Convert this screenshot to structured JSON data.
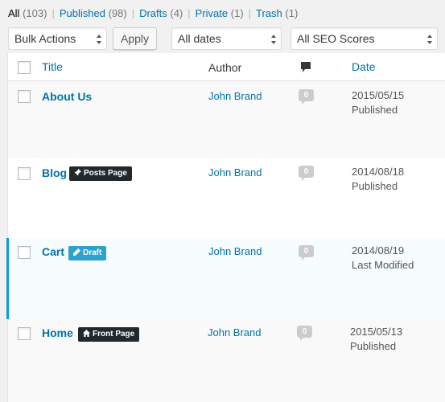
{
  "filters": [
    {
      "label": "All",
      "count": "(103)",
      "current": true
    },
    {
      "label": "Published",
      "count": "(98)"
    },
    {
      "label": "Drafts",
      "count": "(4)"
    },
    {
      "label": "Private",
      "count": "(1)"
    },
    {
      "label": "Trash",
      "count": "(1)"
    }
  ],
  "toolbar": {
    "bulk_actions": "Bulk Actions",
    "apply": "Apply",
    "dates": "All dates",
    "seo": "All SEO Scores"
  },
  "columns": {
    "title": "Title",
    "author": "Author",
    "date": "Date",
    "comments_icon": "comment-icon"
  },
  "rows": [
    {
      "title": "About Us",
      "author": "John Brand",
      "comments": "0",
      "date": "2015/05/15",
      "status": "Published"
    },
    {
      "title": "Blog",
      "badge": "Posts Page",
      "badge_icon": "pin-icon",
      "author": "John Brand",
      "comments": "0",
      "date": "2014/08/18",
      "status": "Published"
    },
    {
      "title": "Cart",
      "badge": "Draft",
      "badge_icon": "pencil-icon",
      "author": "John Brand",
      "comments": "0",
      "date": "2014/08/19",
      "status": "Last Modified"
    },
    {
      "title": "Home",
      "badge": "Front Page",
      "badge_icon": "home-icon",
      "author": "John Brand",
      "comments": "0",
      "date": "2015/05/13",
      "status": "Published"
    }
  ],
  "colors": {
    "link": "#0073aa",
    "badge_dark": "#23282d",
    "badge_draft": "#2ea2cc",
    "row_accent": "#00a0d2"
  }
}
